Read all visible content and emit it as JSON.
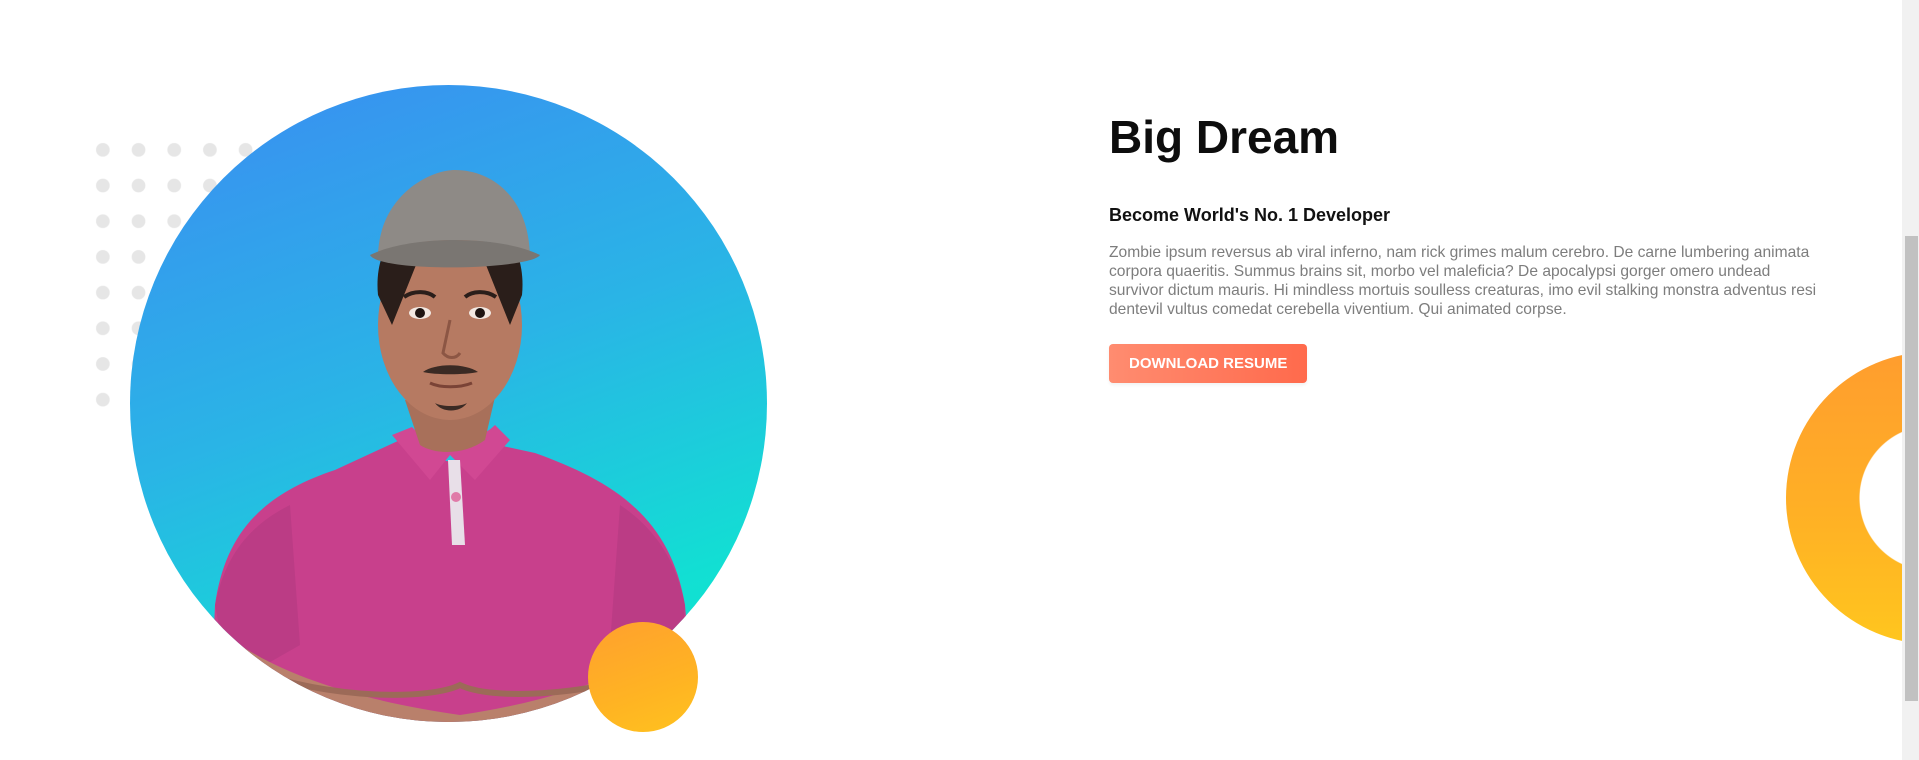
{
  "hero": {
    "title": "Big Dream",
    "subtitle": "Become World's No. 1 Developer",
    "description": "Zombie ipsum reversus ab viral inferno, nam rick grimes malum cerebro. De carne lumbering animata corpora quaeritis. Summus brains sit, morbo vel maleficia? De apocalypsi gorger omero undead survivor dictum mauris. Hi mindless mortuis soulless creaturas, imo evil stalking monstra adventus resi dentevil vultus comedat cerebella viventium. Qui animated corpse.",
    "button_label": "DOWNLOAD RESUME"
  },
  "colors": {
    "circle_gradient_start": "#3b8cf2",
    "circle_gradient_end": "#0ae8cc",
    "accent_orange": "#ffb025",
    "button_start": "#ff8c70",
    "button_end": "#ff6a4c"
  }
}
